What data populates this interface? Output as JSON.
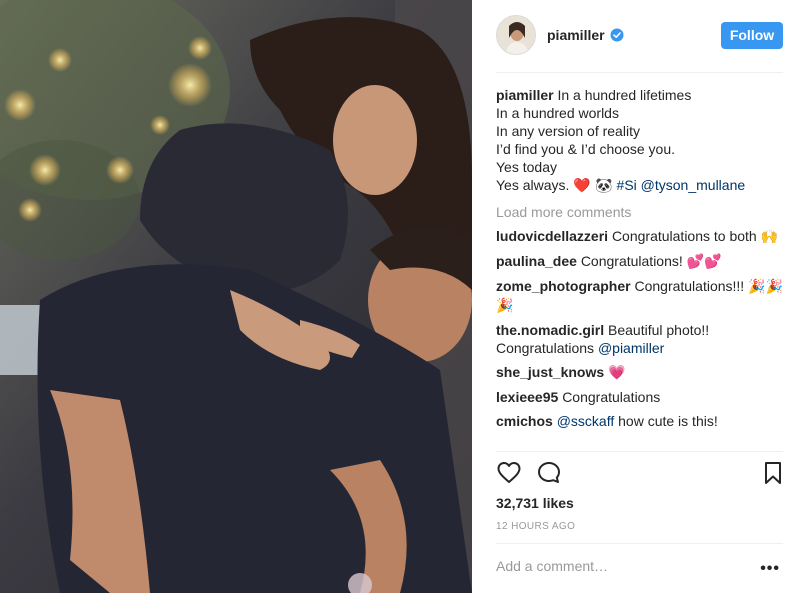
{
  "post": {
    "image_alt": "Couple piggyback photo under string lights",
    "author": {
      "username": "piamiller",
      "verified": true
    },
    "follow_label": "Follow",
    "caption": {
      "username": "piamiller",
      "lines": [
        "In a hundred lifetimes",
        "In a hundred worlds",
        "In any version of reality",
        "I’d find you & I’d choose you.",
        "Yes today"
      ],
      "last_line_text": "Yes always.",
      "last_line_emojis": "❤️ 🐼",
      "hashtag": "#Si",
      "mention": "@tyson_mullane"
    },
    "load_more_label": "Load more comments",
    "comments": [
      {
        "username": "ludovicdellazzeri",
        "text": "Congratulations to both",
        "emoji": "🙌"
      },
      {
        "username": "paulina_dee",
        "text": "Congratulations!",
        "emoji": "💕💕"
      },
      {
        "username": "zome_photographer",
        "text": "Congratulations!!!",
        "emoji": "🎉🎉🎉"
      },
      {
        "username": "the.nomadic.girl",
        "text": "Beautiful photo!! Congratulations",
        "mention": "@piamiller"
      },
      {
        "username": "she_just_knows",
        "text": "",
        "emoji": "💗"
      },
      {
        "username": "lexieee95",
        "text": "Congratulations"
      },
      {
        "username": "cmichos",
        "mention": "@ssckaff",
        "text": "how cute is this!"
      }
    ],
    "likes_label": "32,731 likes",
    "time_label": "12 HOURS AGO",
    "add_comment_placeholder": "Add a comment…",
    "more_label": "•••",
    "colors": {
      "accent": "#3897f0",
      "link": "#003569",
      "muted": "#999999",
      "divider": "#efefef"
    },
    "icons": [
      "heart-icon",
      "comment-icon",
      "bookmark-icon",
      "verified-badge-icon",
      "more-options-icon"
    ]
  }
}
